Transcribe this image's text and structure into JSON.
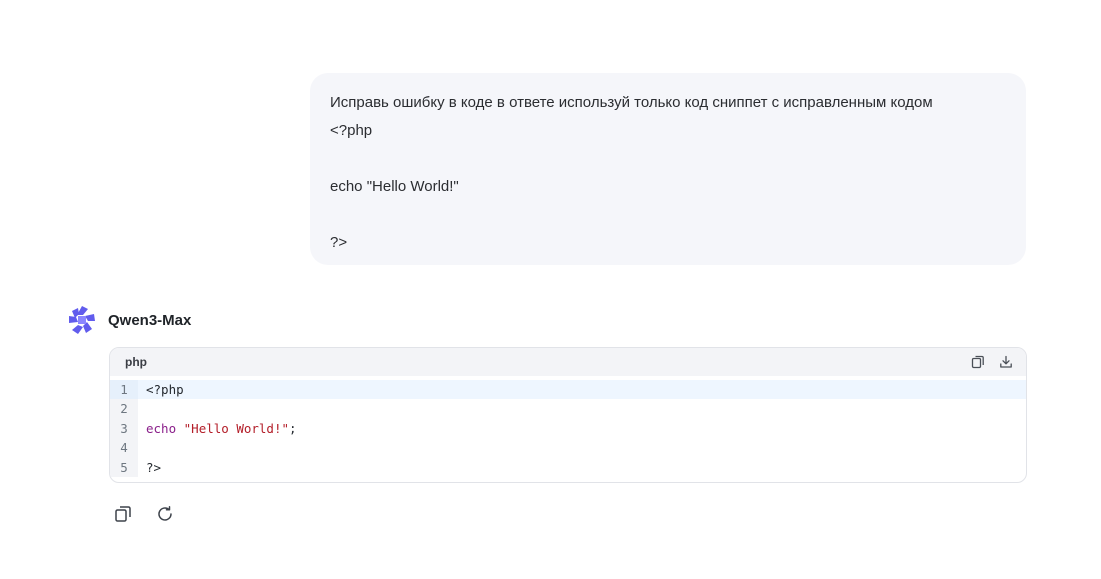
{
  "user_message": {
    "lines": [
      "Исправь ошибку в коде в ответе используй только код сниппет с исправленным кодом",
      "<?php",
      "",
      "echo \"Hello World!\"",
      "",
      "?>"
    ]
  },
  "assistant": {
    "model_name": "Qwen3-Max",
    "logo_icon": "qwen-logo-icon"
  },
  "code_block": {
    "language": "php",
    "tools": [
      "copy-icon",
      "download-icon"
    ],
    "lines": [
      {
        "number": "1",
        "parts": [
          {
            "text": "<?php",
            "kind": "plain"
          }
        ]
      },
      {
        "number": "2",
        "parts": []
      },
      {
        "number": "3",
        "parts": [
          {
            "text": "echo",
            "kind": "kw"
          },
          {
            "text": " ",
            "kind": "plain"
          },
          {
            "text": "\"Hello World!\"",
            "kind": "str"
          },
          {
            "text": ";",
            "kind": "plain"
          }
        ]
      },
      {
        "number": "4",
        "parts": []
      },
      {
        "number": "5",
        "parts": [
          {
            "text": "?>",
            "kind": "plain"
          }
        ]
      }
    ]
  },
  "actions": [
    "copy-icon",
    "regenerate-icon"
  ],
  "colors": {
    "accent": "#615ced",
    "bubble_bg": "#f5f6fa",
    "keyword": "#8a1f8a",
    "string": "#b31d28"
  }
}
